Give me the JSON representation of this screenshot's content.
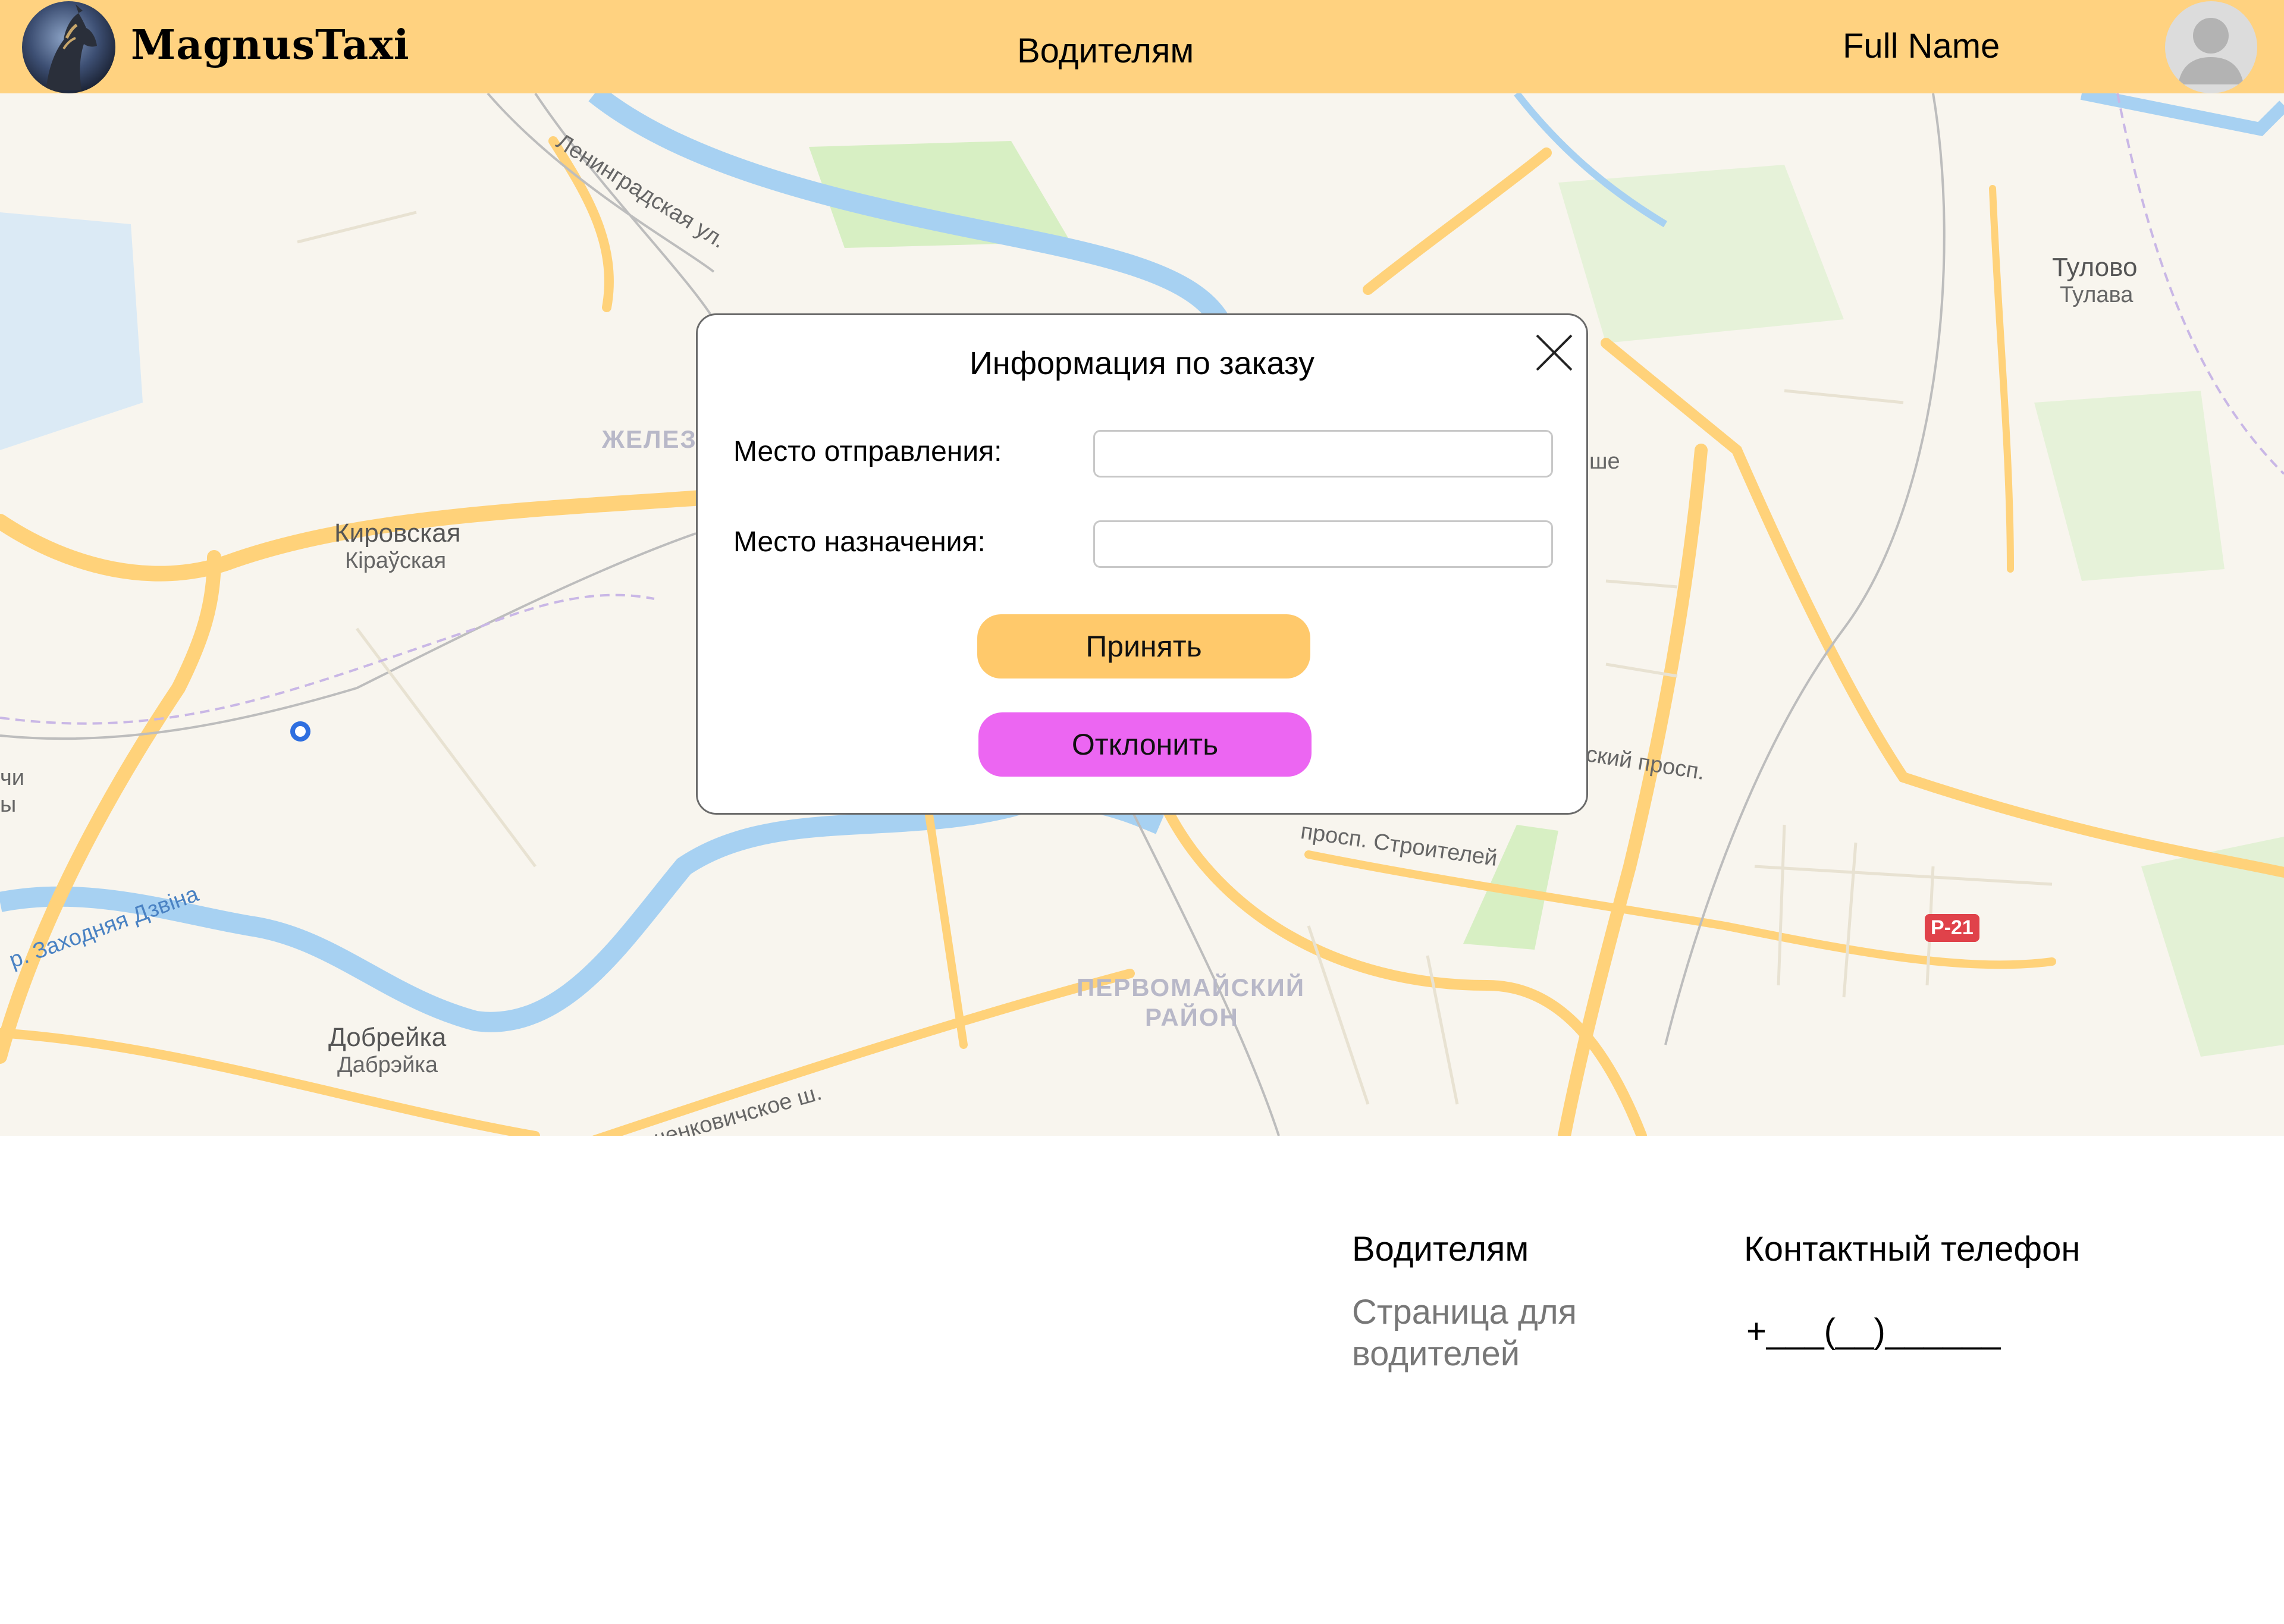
{
  "header": {
    "brand": "MagnusTaxi",
    "nav_link": "Водителям",
    "user_name": "Full Name"
  },
  "map": {
    "labels": {
      "kirovskaya": "Кировская",
      "kirovskaya_by": "Кіраўская",
      "tulovo": "Тулово",
      "tulovo_by": "Тулава",
      "dobreyka": "Добрейка",
      "dobreyka_by": "Дабрэйка",
      "leningradskaya": "Ленинградская ул.",
      "stroiteley": "просп. Строителей",
      "prosp": "ский просп.",
      "beshenkovichskoe": "Бешенковичское ш.",
      "river": "р. Заходняя Дзвіна",
      "district_1": "ПЕРВОМАЙСКИЙ",
      "district_2": "РАЙОН",
      "zhelez": "ЖЕЛЕЗ",
      "shosse": "ше",
      "left_edge_1": "чи",
      "left_edge_2": "ы",
      "road_badge": "P-21"
    },
    "colors": {
      "land": "#f8f5ee",
      "road": "#ffd27a",
      "river": "#a7d1f2",
      "park": "#d3edbf"
    }
  },
  "modal": {
    "title": "Информация по заказу",
    "departure_label": "Место отправления:",
    "departure_value": "",
    "destination_label": "Место назначения:",
    "destination_value": "",
    "accept_label": "Принять",
    "decline_label": "Отклонить"
  },
  "footer": {
    "drivers_heading": "Водителям",
    "drivers_sub": "Страница для водителей",
    "contact_heading": "Контактный телефон",
    "phone": "+___(__)______"
  },
  "colors": {
    "header_bg": "#ffd280",
    "accept": "#ffc96b",
    "decline": "#ec66f2"
  }
}
